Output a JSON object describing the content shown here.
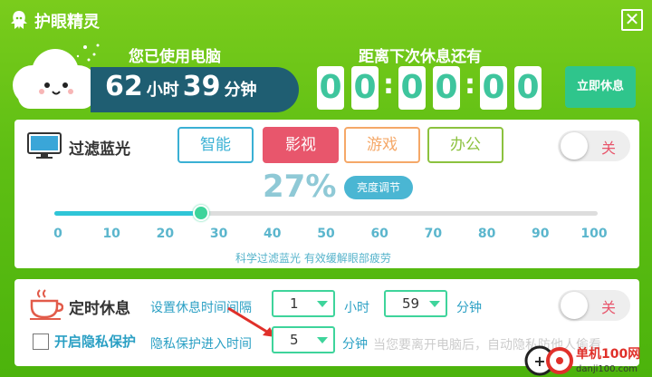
{
  "title": "护眼精灵",
  "close_glyph": "✕",
  "usage": {
    "label": "您已使用电脑",
    "hours": "62",
    "hours_unit": "小时",
    "minutes": "39",
    "minutes_unit": "分钟"
  },
  "countdown": {
    "label": "距离下次休息还有",
    "digits": [
      "0",
      "0",
      "0",
      "0",
      "0",
      "0"
    ],
    "separator": ":"
  },
  "rest_now": "立即休息",
  "filter": {
    "title": "过滤蓝光",
    "modes": [
      "智能",
      "影视",
      "游戏",
      "办公"
    ],
    "active_mode": "影视",
    "toggle": "关",
    "percent_text": "27%",
    "percent_value": 27,
    "brightness_btn": "亮度调节",
    "ticks": [
      "0",
      "10",
      "20",
      "30",
      "40",
      "50",
      "60",
      "70",
      "80",
      "90",
      "100"
    ],
    "hint": "科学过滤蓝光 有效缓解眼部疲劳"
  },
  "rest": {
    "title": "定时休息",
    "interval_label": "设置休息时间间隔",
    "hours_value": "1",
    "hours_unit": "小时",
    "minutes_value": "59",
    "minutes_unit": "分钟",
    "toggle": "关",
    "privacy_label": "开启隐私保护",
    "privacy_time_label": "隐私保护进入时间",
    "privacy_value": "5",
    "privacy_unit": "分钟",
    "privacy_hint": "当您要离开电脑后，自动隐私防他人偷看"
  },
  "watermark": {
    "text": "单机100网",
    "url": "danji100.com"
  },
  "colors": {
    "brand_green": "#5fbf14",
    "accent_teal": "#3ed49b",
    "dark_pill": "#1f5e72",
    "active_red": "#e8566c"
  }
}
